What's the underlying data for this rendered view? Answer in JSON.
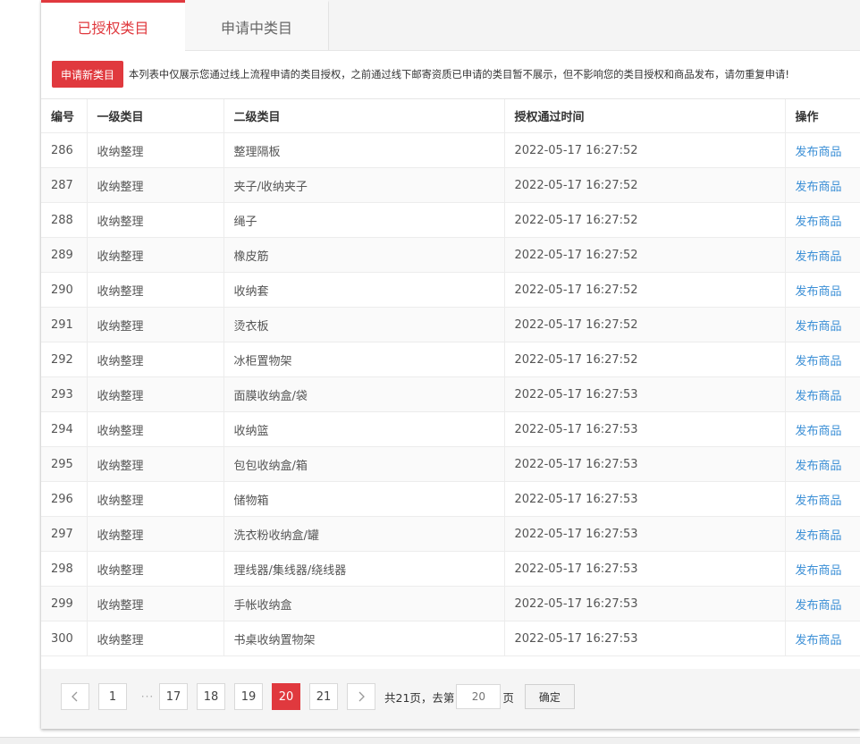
{
  "tabs": [
    {
      "label": "已授权类目",
      "active": true
    },
    {
      "label": "申请中类目",
      "active": false
    }
  ],
  "notice": {
    "button_label": "申请新类目",
    "text": "本列表中仅展示您通过线上流程申请的类目授权，之前通过线下邮寄资质已申请的类目暂不展示，但不影响您的类目授权和商品发布，请勿重复申请!"
  },
  "table": {
    "headers": [
      "编号",
      "一级类目",
      "二级类目",
      "授权通过时间",
      "操作"
    ],
    "rows": [
      {
        "id": "286",
        "cat1": "收纳整理",
        "cat2": "整理隔板",
        "time": "2022-05-17 16:27:52",
        "action": "发布商品"
      },
      {
        "id": "287",
        "cat1": "收纳整理",
        "cat2": "夹子/收纳夹子",
        "time": "2022-05-17 16:27:52",
        "action": "发布商品"
      },
      {
        "id": "288",
        "cat1": "收纳整理",
        "cat2": "绳子",
        "time": "2022-05-17 16:27:52",
        "action": "发布商品"
      },
      {
        "id": "289",
        "cat1": "收纳整理",
        "cat2": "橡皮筋",
        "time": "2022-05-17 16:27:52",
        "action": "发布商品"
      },
      {
        "id": "290",
        "cat1": "收纳整理",
        "cat2": "收纳套",
        "time": "2022-05-17 16:27:52",
        "action": "发布商品"
      },
      {
        "id": "291",
        "cat1": "收纳整理",
        "cat2": "烫衣板",
        "time": "2022-05-17 16:27:52",
        "action": "发布商品"
      },
      {
        "id": "292",
        "cat1": "收纳整理",
        "cat2": "冰柜置物架",
        "time": "2022-05-17 16:27:52",
        "action": "发布商品"
      },
      {
        "id": "293",
        "cat1": "收纳整理",
        "cat2": "面膜收纳盒/袋",
        "time": "2022-05-17 16:27:53",
        "action": "发布商品"
      },
      {
        "id": "294",
        "cat1": "收纳整理",
        "cat2": "收纳篮",
        "time": "2022-05-17 16:27:53",
        "action": "发布商品"
      },
      {
        "id": "295",
        "cat1": "收纳整理",
        "cat2": "包包收纳盒/箱",
        "time": "2022-05-17 16:27:53",
        "action": "发布商品"
      },
      {
        "id": "296",
        "cat1": "收纳整理",
        "cat2": "储物箱",
        "time": "2022-05-17 16:27:53",
        "action": "发布商品"
      },
      {
        "id": "297",
        "cat1": "收纳整理",
        "cat2": "洗衣粉收纳盒/罐",
        "time": "2022-05-17 16:27:53",
        "action": "发布商品"
      },
      {
        "id": "298",
        "cat1": "收纳整理",
        "cat2": "理线器/集线器/绕线器",
        "time": "2022-05-17 16:27:53",
        "action": "发布商品"
      },
      {
        "id": "299",
        "cat1": "收纳整理",
        "cat2": "手帐收纳盒",
        "time": "2022-05-17 16:27:53",
        "action": "发布商品"
      },
      {
        "id": "300",
        "cat1": "收纳整理",
        "cat2": "书桌收纳置物架",
        "time": "2022-05-17 16:27:53",
        "action": "发布商品"
      }
    ]
  },
  "pagination": {
    "prev_icon": "chevron-left-icon",
    "next_icon": "chevron-right-icon",
    "first_page": "1",
    "ellipsis": "···",
    "pages": [
      "17",
      "18",
      "19",
      "20",
      "21"
    ],
    "current": "20",
    "total_text": "共21页，去第",
    "goto_placeholder": "20",
    "page_suffix": "页",
    "confirm_label": "确定"
  },
  "colors": {
    "accent": "#e0393e",
    "link": "#3b8fd6"
  }
}
